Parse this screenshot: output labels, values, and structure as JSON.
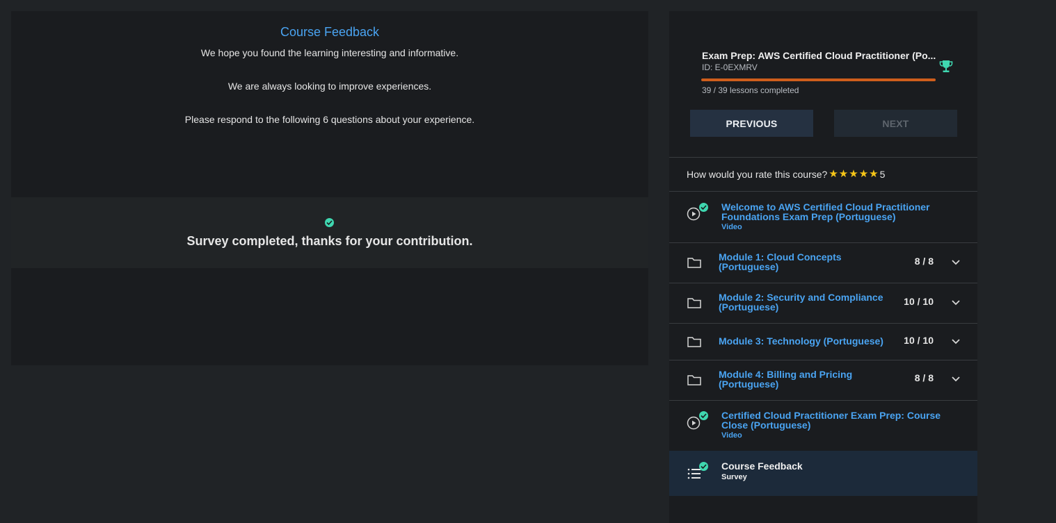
{
  "feedback": {
    "title": "Course Feedback",
    "line1": "We hope you found the learning interesting and informative.",
    "line2": "We are always looking to improve experiences.",
    "line3": "Please respond to the following 6 questions about your experience.",
    "completed_message": "Survey completed, thanks for your contribution."
  },
  "course": {
    "title": "Exam Prep: AWS Certified Cloud Practitioner (Po...",
    "id": "ID: E-0EXMRV",
    "progress_fraction": 1.0,
    "lessons_completed": "39 / 39 lessons completed",
    "previous_label": "PREVIOUS",
    "next_label": "NEXT"
  },
  "rating": {
    "question": "How would you rate this course?",
    "stars": 5,
    "value": "5"
  },
  "lessons": [
    {
      "kind": "video",
      "title_line1": "Welcome to AWS Certified Cloud Practitioner",
      "title_line2": "Foundations Exam Prep (Portuguese)",
      "type": "Video"
    },
    {
      "kind": "module",
      "title_line1": "Module 1: Cloud Concepts",
      "title_line2": "(Portuguese)",
      "count": "8 / 8"
    },
    {
      "kind": "module",
      "title_line1": "Module 2: Security and Compliance",
      "title_line2": "(Portuguese)",
      "count": "10 / 10"
    },
    {
      "kind": "module",
      "title_line1": "Module 3: Technology (Portuguese)",
      "count": "10 / 10"
    },
    {
      "kind": "module",
      "title_line1": "Module 4: Billing and Pricing",
      "title_line2": "(Portuguese)",
      "count": "8 / 8"
    },
    {
      "kind": "video",
      "title_line1": "Certified Cloud Practitioner Exam Prep: Course",
      "title_line2": "Close (Portuguese)",
      "type": "Video"
    },
    {
      "kind": "survey",
      "title_line1": "Course Feedback",
      "type": "Survey"
    }
  ],
  "colors": {
    "accent_blue": "#4aa4f2",
    "progress": "#cf5e1c",
    "check": "#3fd7b0",
    "star": "#f5c518"
  }
}
